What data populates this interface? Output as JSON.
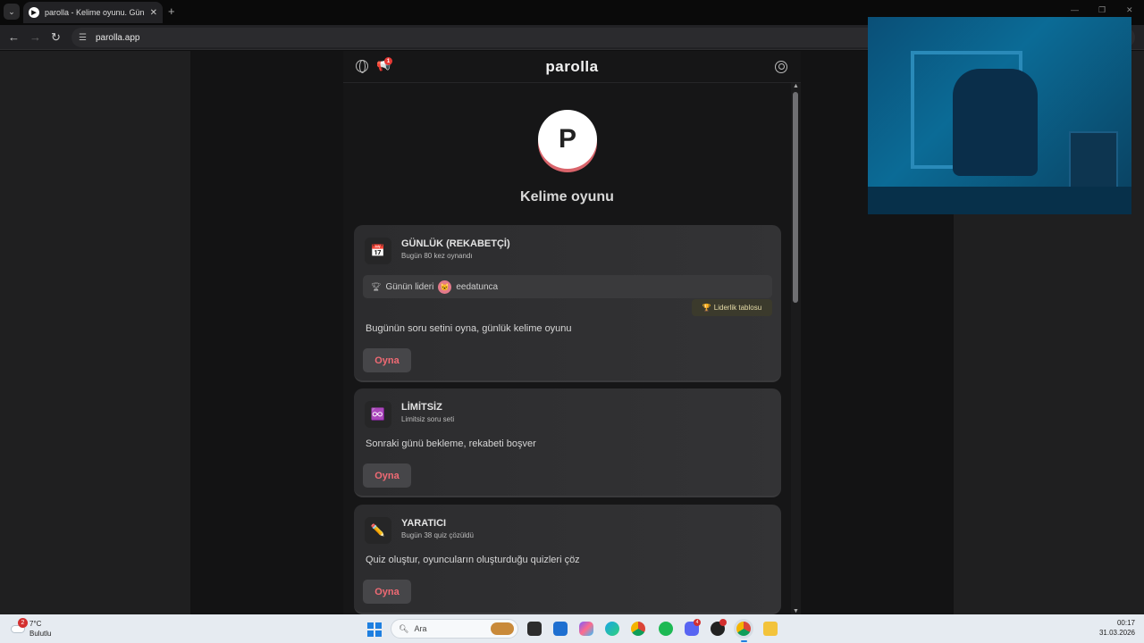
{
  "browser": {
    "tab_title": "parolla - Kelime oyunu. Günlük",
    "url": "parolla.app",
    "new_tab_glyph": "+",
    "close_glyph": "✕"
  },
  "app": {
    "brand": "parolla",
    "logo_letter": "P",
    "page_title": "Kelime oyunu",
    "notification_count": "1",
    "cards": [
      {
        "title": "GÜNLÜK (REKABETÇİ)",
        "subtitle": "Bugün 80 kez oynandı",
        "icon": "calendar-icon",
        "leader_label": "Günün lideri",
        "leader_name": "eedatunca",
        "leaderboard_label": "Liderlik tablosu",
        "description": "Bugünün soru setini oyna, günlük kelime oyunu",
        "button": "Oyna"
      },
      {
        "title": "LİMİTSİZ",
        "subtitle": "Limitsiz soru seti",
        "icon": "infinity-icon",
        "description": "Sonraki günü bekleme, rekabeti boşver",
        "button": "Oyna"
      },
      {
        "title": "YARATICI",
        "subtitle": "Bugün 38 quiz çözüldü",
        "icon": "pencil-icon",
        "description": "Quiz oluştur, oyuncuların oluşturduğu quizleri çöz",
        "button": "Oyna"
      }
    ]
  },
  "taskbar": {
    "weather_badge": "2",
    "weather_temp": "7°C",
    "weather_condition": "Bulutlu",
    "search_placeholder": "Ara",
    "discord_badge": "4",
    "time": "00:17",
    "date": "31.03.2026"
  },
  "colors": {
    "accent_pink": "#f06a74",
    "logo_shadow": "#d9646b"
  }
}
